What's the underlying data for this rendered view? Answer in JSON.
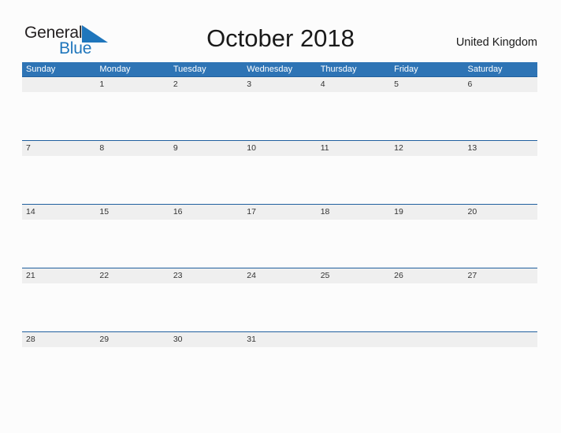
{
  "brand": {
    "word_general": "General",
    "word_blue": "Blue",
    "flag_icon": "blue-triangle-flag-icon",
    "flag_color": "#1f76bc",
    "general_color": "#231f20"
  },
  "header": {
    "title": "October 2018",
    "country": "United Kingdom"
  },
  "theme": {
    "header_blue": "#2e74b5",
    "row_divider_blue": "#205f9e",
    "band_gray": "#efefef",
    "page_background": "#fcfcfc",
    "text_dark": "#333333"
  },
  "calendar": {
    "month": "October",
    "year": "2018",
    "weekday_headers": [
      "Sunday",
      "Monday",
      "Tuesday",
      "Wednesday",
      "Thursday",
      "Friday",
      "Saturday"
    ],
    "weeks": [
      {
        "days": [
          {
            "label": "",
            "empty": true
          },
          {
            "label": "1",
            "empty": false
          },
          {
            "label": "2",
            "empty": false
          },
          {
            "label": "3",
            "empty": false
          },
          {
            "label": "4",
            "empty": false
          },
          {
            "label": "5",
            "empty": false
          },
          {
            "label": "6",
            "empty": false
          }
        ]
      },
      {
        "days": [
          {
            "label": "7",
            "empty": false
          },
          {
            "label": "8",
            "empty": false
          },
          {
            "label": "9",
            "empty": false
          },
          {
            "label": "10",
            "empty": false
          },
          {
            "label": "11",
            "empty": false
          },
          {
            "label": "12",
            "empty": false
          },
          {
            "label": "13",
            "empty": false
          }
        ]
      },
      {
        "days": [
          {
            "label": "14",
            "empty": false
          },
          {
            "label": "15",
            "empty": false
          },
          {
            "label": "16",
            "empty": false
          },
          {
            "label": "17",
            "empty": false
          },
          {
            "label": "18",
            "empty": false
          },
          {
            "label": "19",
            "empty": false
          },
          {
            "label": "20",
            "empty": false
          }
        ]
      },
      {
        "days": [
          {
            "label": "21",
            "empty": false
          },
          {
            "label": "22",
            "empty": false
          },
          {
            "label": "23",
            "empty": false
          },
          {
            "label": "24",
            "empty": false
          },
          {
            "label": "25",
            "empty": false
          },
          {
            "label": "26",
            "empty": false
          },
          {
            "label": "27",
            "empty": false
          }
        ]
      },
      {
        "days": [
          {
            "label": "28",
            "empty": false
          },
          {
            "label": "29",
            "empty": false
          },
          {
            "label": "30",
            "empty": false
          },
          {
            "label": "31",
            "empty": false
          },
          {
            "label": "",
            "empty": true
          },
          {
            "label": "",
            "empty": true
          },
          {
            "label": "",
            "empty": true
          }
        ]
      }
    ]
  }
}
